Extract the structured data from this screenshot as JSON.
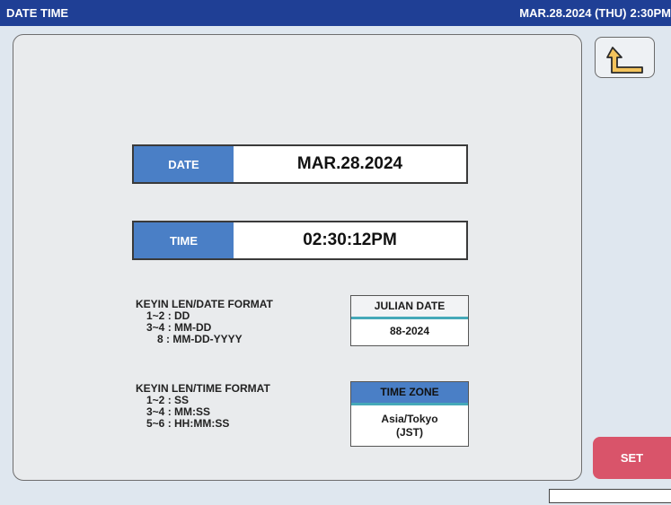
{
  "title_bar": {
    "title": "DATE TIME",
    "date": "MAR.28.2024 (THU)",
    "time": "2:30PM"
  },
  "back_button": {
    "icon": "return-arrow-icon"
  },
  "date_field": {
    "label": "DATE",
    "value": "MAR.28.2024"
  },
  "time_field": {
    "label": "TIME",
    "value": "02:30:12PM"
  },
  "date_format": {
    "heading": "KEYIN LEN/DATE FORMAT",
    "lines": [
      "1~2 : DD",
      "3~4 : MM-DD",
      "8 : MM-DD-YYYY"
    ]
  },
  "time_format": {
    "heading": "KEYIN LEN/TIME FORMAT",
    "lines": [
      "1~2 : SS",
      "3~4 : MM:SS",
      "5~6 : HH:MM:SS"
    ]
  },
  "julian_date": {
    "label": "JULIAN DATE",
    "value": "88-2024"
  },
  "time_zone": {
    "label": "TIME ZONE",
    "value_line1": "Asia/Tokyo",
    "value_line2": "(JST)"
  },
  "set_button": {
    "label": "SET"
  },
  "colors": {
    "title_bar": "#1f3f95",
    "field_label": "#4a7fc6",
    "set_button": "#d9546a",
    "accent_line": "#45a9b9"
  }
}
